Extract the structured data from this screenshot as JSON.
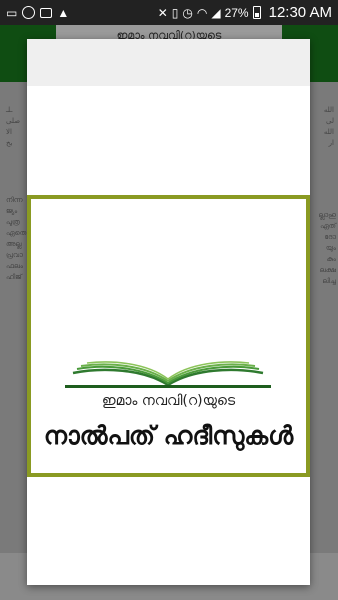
{
  "status_bar": {
    "battery": "27%",
    "time": "12:30 AM"
  },
  "app": {
    "header_title": "ഇമാം നവവി(റ)യുടെ"
  },
  "splash": {
    "subtitle": "ഇമാം നവവി(റ)യുടെ",
    "title": "നാൽപത് ഹദീസുകൾ",
    "frame_color": "#8a9a22"
  }
}
